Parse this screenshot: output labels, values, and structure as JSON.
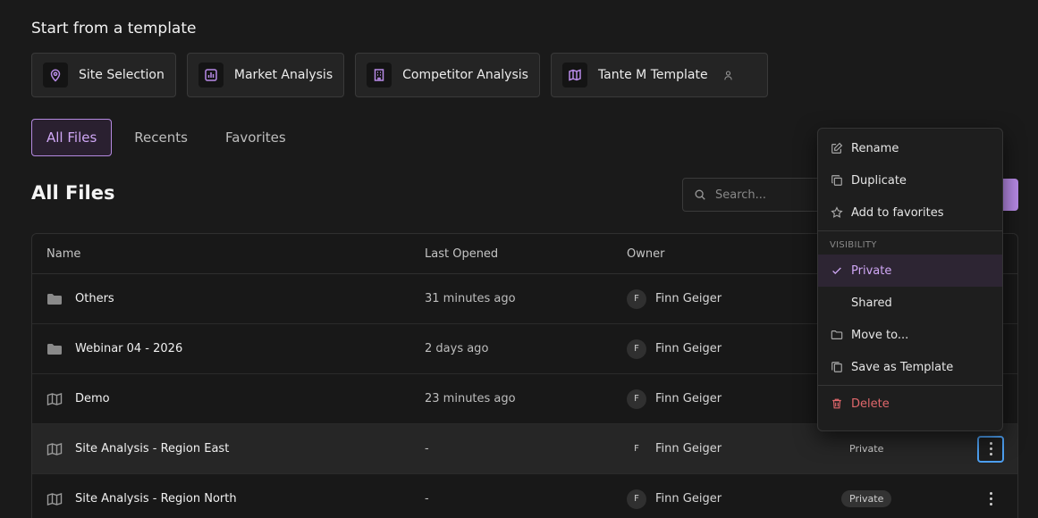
{
  "templates_section": {
    "title": "Start from a template",
    "items": [
      {
        "label": "Site Selection",
        "icon": "pin-icon"
      },
      {
        "label": "Market Analysis",
        "icon": "bar-chart-icon"
      },
      {
        "label": "Competitor Analysis",
        "icon": "building-icon"
      },
      {
        "label": "Tante M Template",
        "icon": "map-icon"
      }
    ]
  },
  "tabs": [
    {
      "label": "All Files",
      "active": true
    },
    {
      "label": "Recents",
      "active": false
    },
    {
      "label": "Favorites",
      "active": false
    }
  ],
  "page_title": "All Files",
  "search": {
    "placeholder": "Search..."
  },
  "table": {
    "headers": {
      "name": "Name",
      "last_opened": "Last Opened",
      "owner": "Owner"
    },
    "rows": [
      {
        "name": "Others",
        "type": "folder",
        "last_opened": "31 minutes ago",
        "owner": "Finn Geiger",
        "initial": "F",
        "visibility": ""
      },
      {
        "name": "Webinar 04 - 2026",
        "type": "folder",
        "last_opened": "2 days ago",
        "owner": "Finn Geiger",
        "initial": "F",
        "visibility": ""
      },
      {
        "name": "Demo",
        "type": "map",
        "last_opened": "23 minutes ago",
        "owner": "Finn Geiger",
        "initial": "F",
        "visibility": ""
      },
      {
        "name": "Site Analysis - Region East",
        "type": "map",
        "last_opened": "-",
        "owner": "Finn Geiger",
        "initial": "F",
        "visibility": "Private"
      },
      {
        "name": "Site Analysis - Region North",
        "type": "map",
        "last_opened": "-",
        "owner": "Finn Geiger",
        "initial": "F",
        "visibility": "Private"
      }
    ]
  },
  "context_menu": {
    "rename": "Rename",
    "duplicate": "Duplicate",
    "favorites": "Add to favorites",
    "visibility_label": "VISIBILITY",
    "private": "Private",
    "shared": "Shared",
    "move": "Move to...",
    "save_template": "Save as Template",
    "delete": "Delete"
  },
  "colors": {
    "accent": "#b78ae6",
    "danger": "#e0676b",
    "focus": "#4d9ff0"
  }
}
